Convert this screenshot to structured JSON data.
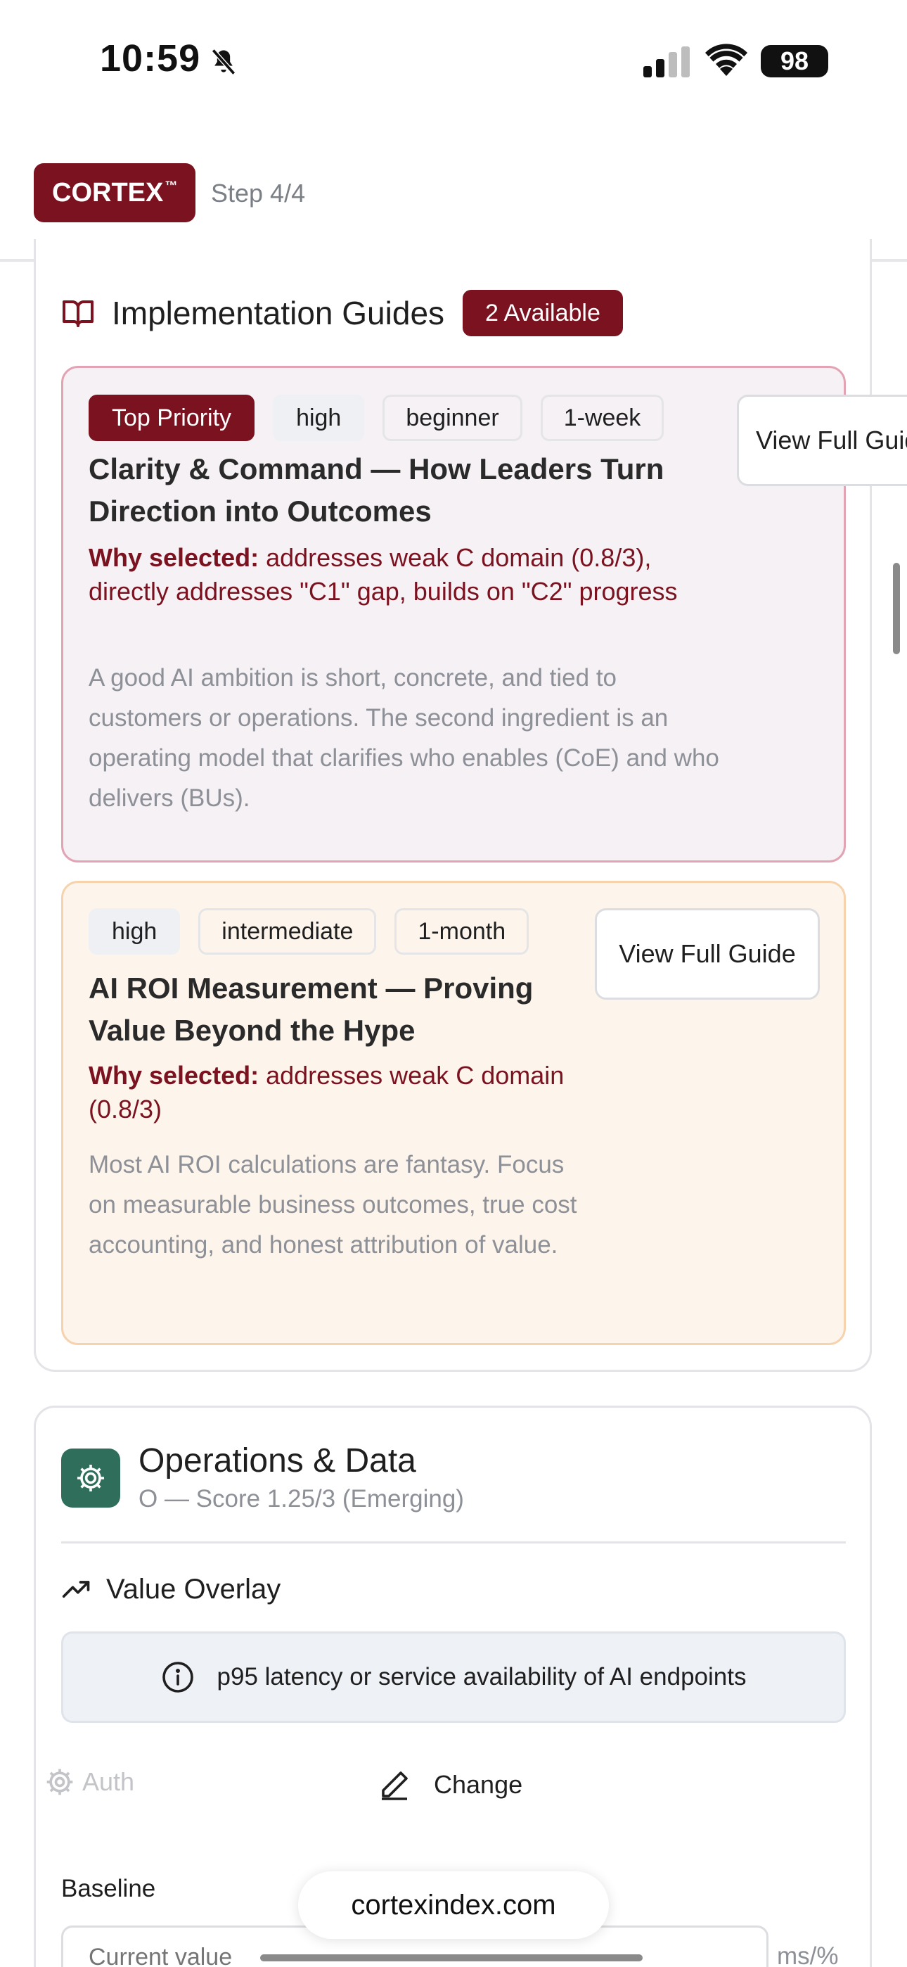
{
  "status_bar": {
    "time": "10:59",
    "battery": "98"
  },
  "header": {
    "logo": "CORTEX",
    "logo_tm": "™",
    "step": "Step 4/4"
  },
  "guides_section": {
    "title": "Implementation Guides",
    "badge": "2 Available",
    "guides": [
      {
        "priority_tag": "Top Priority",
        "tags": [
          "high",
          "beginner",
          "1-week"
        ],
        "title": "Clarity & Command — How Leaders Turn Direction into Outcomes",
        "why_label": "Why selected:",
        "why_text": " addresses weak C domain (0.8/3), directly addresses \"C1\" gap, builds on \"C2\" progress",
        "description": "A good AI ambition is short, concrete, and tied to customers or operations. The second ingredient is an operating model that clarifies who enables (CoE) and who delivers (BUs).",
        "button": "View Full Guide"
      },
      {
        "tags": [
          "high",
          "intermediate",
          "1-month"
        ],
        "title": "AI ROI Measurement — Proving Value Beyond the Hype",
        "why_label": "Why selected:",
        "why_text": " addresses weak C domain (0.8/3)",
        "description": "Most AI ROI calculations are fantasy. Focus on measurable business outcomes, true cost accounting, and honest attribution of value.",
        "button": "View Full Guide"
      }
    ]
  },
  "ops_section": {
    "title": "Operations & Data",
    "subtitle": "O — Score 1.25/3 (Emerging)",
    "overlay_title": "Value Overlay",
    "info_text": "p95 latency or service availability of AI endpoints",
    "auth_label": "Auth",
    "change_label": "Change",
    "baseline_label": "Baseline",
    "baseline_placeholder": "Current value",
    "unit": "ms/%"
  },
  "browser": {
    "url": "cortexindex.com"
  },
  "colors": {
    "brand": "#7a1220",
    "ops_icon": "#2e6e5a",
    "guide1_bg": "#f5f1f4",
    "guide2_bg": "#fdf5ec"
  },
  "icons": [
    "bell-slash-icon",
    "signal-icon",
    "wifi-icon",
    "book-icon",
    "gear-icon",
    "trend-up-icon",
    "info-icon",
    "auth-gear-icon",
    "pencil-icon"
  ]
}
